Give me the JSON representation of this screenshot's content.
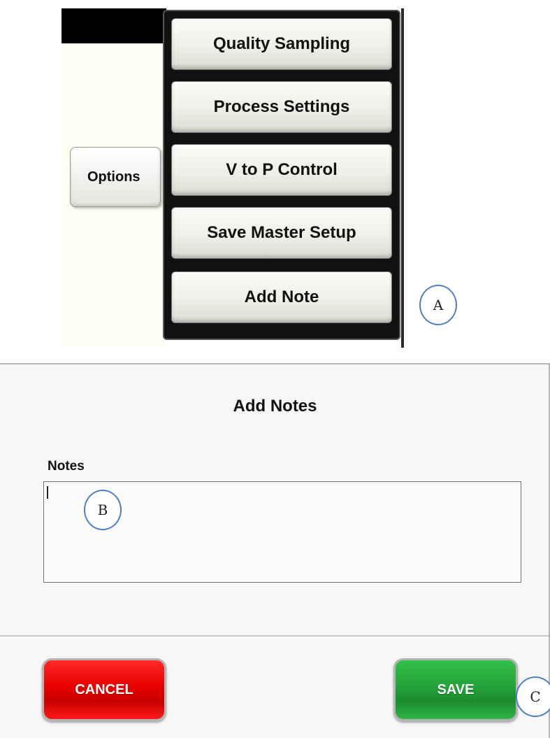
{
  "menu": {
    "options_label": "Options",
    "items": [
      {
        "label": "Quality Sampling"
      },
      {
        "label": "Process Settings"
      },
      {
        "label": "V to P Control"
      },
      {
        "label": "Save Master Setup"
      },
      {
        "label": "Add Note"
      }
    ]
  },
  "callouts": {
    "a": "A",
    "b": "B",
    "c": "C"
  },
  "dialog": {
    "title": "Add Notes",
    "notes_label": "Notes",
    "notes_value": "",
    "cancel_label": "CANCEL",
    "save_label": "SAVE"
  },
  "colors": {
    "cancel": "#e80000",
    "save": "#25a23a",
    "callout_border": "#4f7fc0"
  }
}
